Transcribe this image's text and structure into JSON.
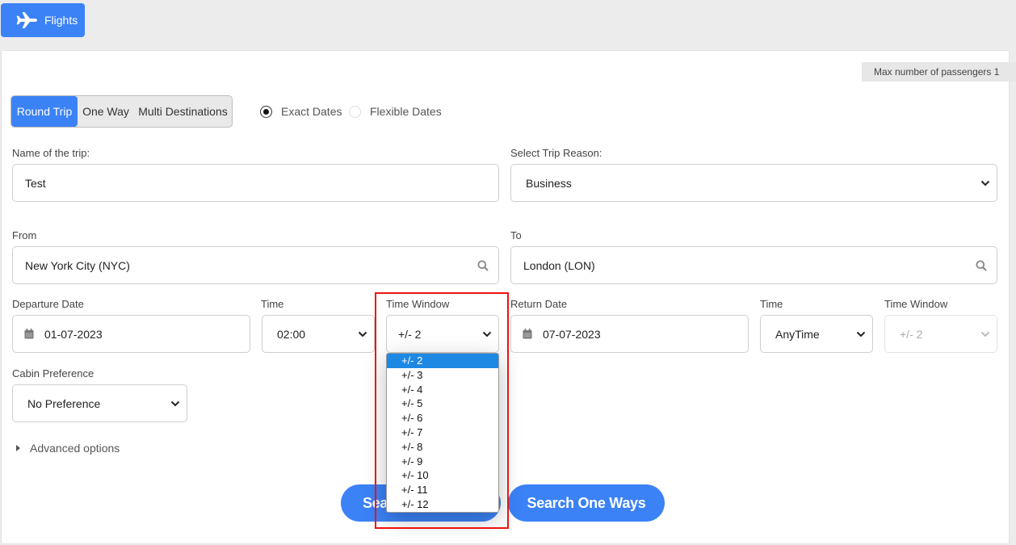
{
  "top_tab": {
    "label": "Flights",
    "icon": "airplane-icon"
  },
  "info": {
    "max_passengers": "Max number of passengers 1"
  },
  "trip_type": {
    "options": [
      {
        "label": "Round Trip",
        "active": true
      },
      {
        "label": "One Way",
        "active": false
      },
      {
        "label": "Multi Destinations",
        "active": false
      }
    ]
  },
  "date_mode": {
    "exact": "Exact Dates",
    "flexible": "Flexible Dates",
    "selected": "exact"
  },
  "form": {
    "trip_name": {
      "label": "Name of the trip:",
      "value": "Test"
    },
    "trip_reason": {
      "label": "Select Trip Reason:",
      "value": "Business"
    },
    "from": {
      "label": "From",
      "value": "New York City (NYC)"
    },
    "to": {
      "label": "To",
      "value": "London (LON)"
    },
    "departure_date": {
      "label": "Departure Date",
      "value": "01-07-2023"
    },
    "departure_time": {
      "label": "Time",
      "value": "02:00"
    },
    "departure_window": {
      "label": "Time Window",
      "value": "+/- 2"
    },
    "return_date": {
      "label": "Return Date",
      "value": "07-07-2023"
    },
    "return_time": {
      "label": "Time",
      "value": "AnyTime"
    },
    "return_window": {
      "label": "Time Window",
      "value": "+/- 2"
    },
    "cabin": {
      "label": "Cabin Preference",
      "value": "No Preference"
    }
  },
  "time_window_options": [
    "+/- 2",
    "+/- 3",
    "+/- 4",
    "+/- 5",
    "+/- 6",
    "+/- 7",
    "+/- 8",
    "+/- 9",
    "+/- 10",
    "+/- 11",
    "+/- 12"
  ],
  "advanced": {
    "label": "Advanced options"
  },
  "buttons": {
    "search_round": "Search Round Trips",
    "search_one_ways": "Search One Ways"
  },
  "colors": {
    "accent": "#3b82f6",
    "highlight_box": "#e11111",
    "selected_option": "#1e88e5"
  }
}
